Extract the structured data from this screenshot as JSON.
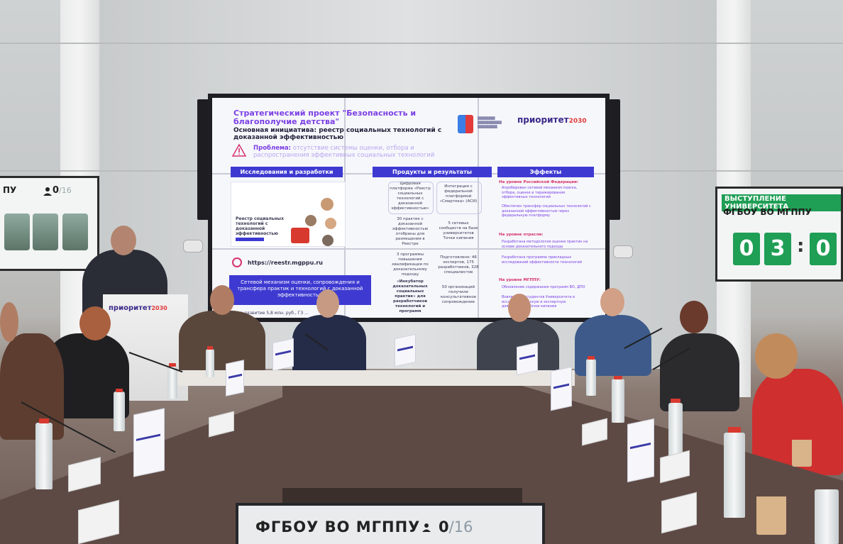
{
  "main_slide": {
    "title": "Стратегический проект \"Безопасность и благополучие детства\"",
    "subtitle": "Основная инициатива: реестр социальных технологий с доказанной эффективностью",
    "problem_label": "Проблема:",
    "problem_text": "отсутствие системы оценки, отбора и распространения эффективных социальных технологий",
    "logo_text": "приоритет",
    "logo_year": "2030",
    "columns": [
      "Исследования и разработки",
      "Продукты и результаты",
      "Эффекты"
    ],
    "registry_label": "Реестр социальных технологий с доказанной эффективностью",
    "url": "https://reestr.mgppu.ru",
    "network_text": "Сетевой механизм оценки, сопровождения и трансфера практик и технологий с доказанной эффективностью",
    "budget_text": "...на развитие 5,8 млн. руб., ГЗ ...",
    "products": [
      "Цифровая платформа «Реестр социальных технологий с доказанной эффективностью»",
      "30 практик с доказанной эффективностью отобраны для размещения в Реестре",
      "3 программы повышения квалификации по доказательному подходу",
      "«Инкубатор доказательных социальных практик» для разработчиков технологий и программ"
    ],
    "products_right": [
      "Интеграция с федеральной платформой «Смартека» (АСИ)",
      "5 сетевых сообществ на базе университетов Точки кипения",
      "Подготовлено: 46 экспертов, 175 разработчиков, 328 специалистов",
      "50 организаций получили консультативное сопровождение"
    ],
    "effects_heads": [
      "На уровне Российской Федерации:",
      "На уровне отрасли:",
      "На уровне МГППУ:"
    ],
    "effects": [
      "Апробирован сетевой механизм поиска, отбора, оценки и тиражирования эффективных технологий",
      "Обеспечен трансфер социальных технологий с доказанной эффективностью через федеральную платформу",
      "Разработана методология оценки практик на основе доказательного подхода",
      "Разработана программа прикладных исследований эффективности технологий",
      "Обновление содержания программ ВО, ДПО",
      "Вовлечение студентов Университета в исследовательскую и экспертную деятельность Точки кипения"
    ]
  },
  "right_screen": {
    "tag": "ВЫСТУПЛЕНИЕ УНИВЕРСИТЕТА",
    "name": "ФГБОУ ВО МГППУ",
    "timer": [
      "0",
      "3",
      ":",
      "0"
    ]
  },
  "left_screen": {
    "name": "ПУ",
    "count": "0",
    "total": "/16"
  },
  "bottom_screen": {
    "name": "ФГБОУ ВО МГППУ",
    "count": "0",
    "total": "/16"
  },
  "podium": {
    "logo_text": "приоритет",
    "logo_year": "2030"
  },
  "colors": {
    "accent_purple": "#7b3fe4",
    "header_blue": "#3e3ad1",
    "timer_green": "#1f9e55",
    "brand_red": "#e23b3b"
  }
}
